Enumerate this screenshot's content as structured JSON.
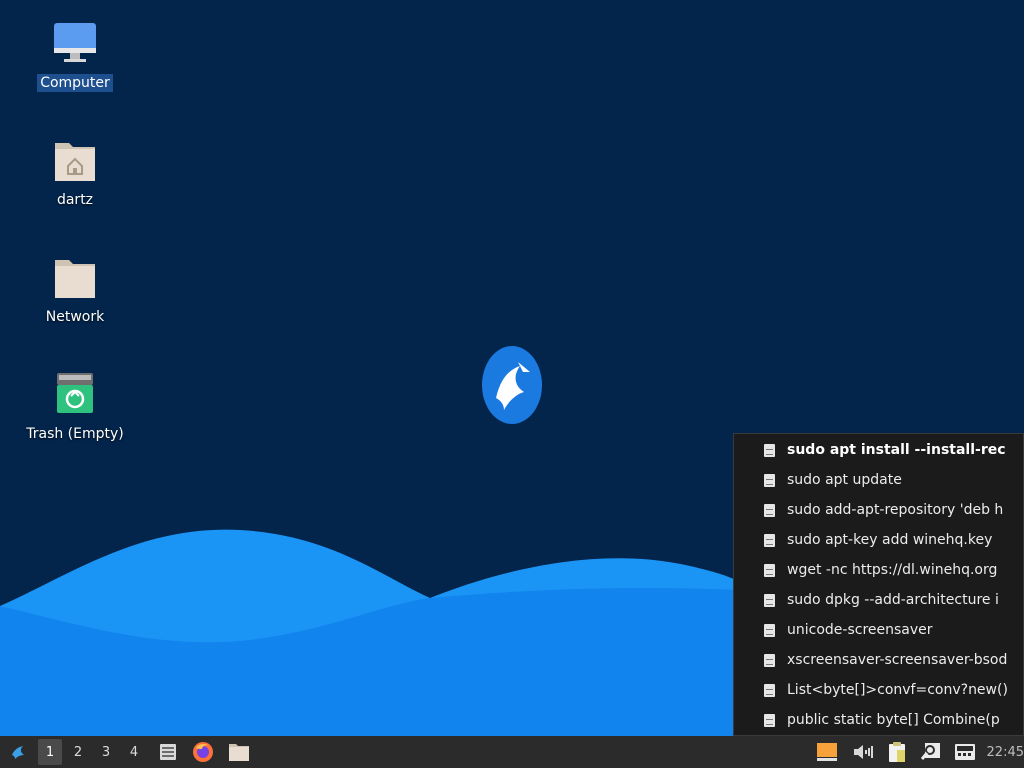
{
  "desktop": {
    "icons": [
      {
        "label": "Computer",
        "icon": "computer-icon",
        "selected": true
      },
      {
        "label": "dartz",
        "icon": "home-folder-icon"
      },
      {
        "label": "Network",
        "icon": "network-folder-icon"
      },
      {
        "label": "Trash (Empty)",
        "icon": "trash-icon"
      }
    ],
    "wallpaper_colors": {
      "background": "#03254c",
      "wave_light": "#1b95f5",
      "wave_dark": "#0a6fe0"
    }
  },
  "clipboard_menu": {
    "items": [
      {
        "text": "sudo apt install --install-rec",
        "bold": true
      },
      {
        "text": "sudo apt update"
      },
      {
        "text": "sudo add-apt-repository 'deb h"
      },
      {
        "text": "sudo apt-key add winehq.key"
      },
      {
        "text": "wget -nc https://dl.winehq.org"
      },
      {
        "text": "sudo dpkg --add-architecture i"
      },
      {
        "text": "unicode-screensaver"
      },
      {
        "text": "xscreensaver-screensaver-bsod"
      },
      {
        "text": "List<byte[]>convf=conv?new()"
      },
      {
        "text": "public static byte[] Combine(p"
      }
    ]
  },
  "taskbar": {
    "workspaces": [
      "1",
      "2",
      "3",
      "4"
    ],
    "active_workspace": "1",
    "launchers": [
      "file-manager-icon",
      "firefox-icon",
      "folder-icon"
    ],
    "tray": [
      "battery-icon",
      "volume-icon",
      "clipboard-icon",
      "search-icon",
      "keyboard-icon"
    ],
    "clock": "22:45"
  }
}
